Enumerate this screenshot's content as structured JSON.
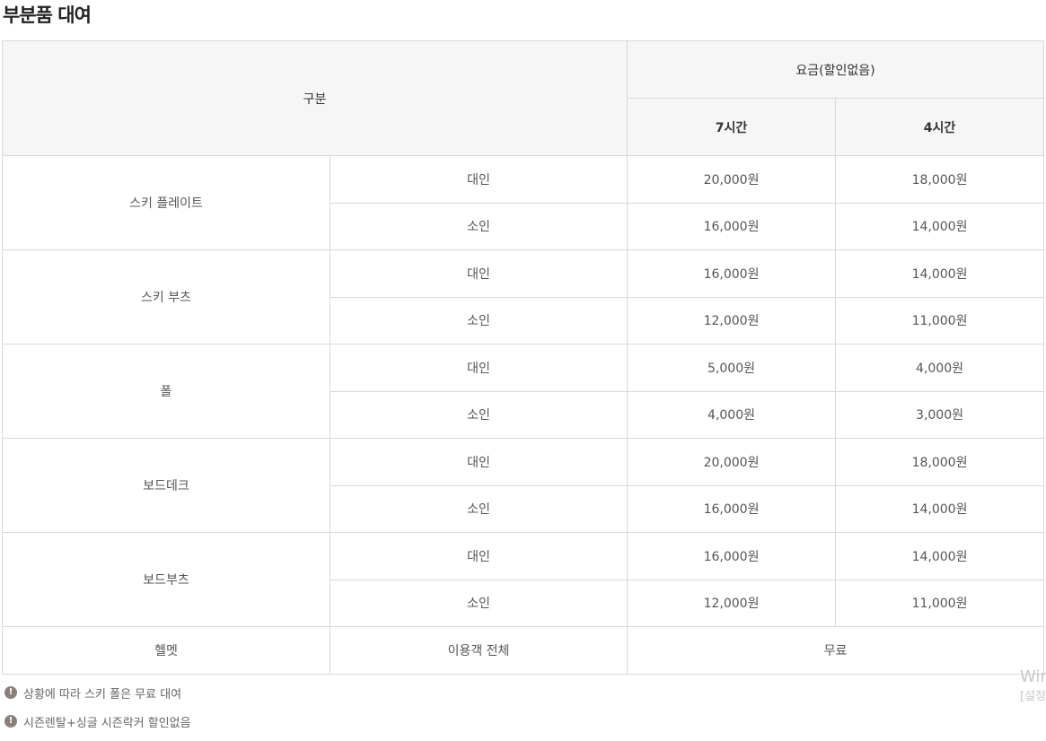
{
  "page": {
    "title": "부분품 대여"
  },
  "table": {
    "header": {
      "category": "구분",
      "price_group": "요금(할인없음)",
      "col_7h": "7시간",
      "col_4h": "4시간"
    },
    "groups": [
      {
        "name": "스키 플레이트",
        "rows": [
          {
            "type": "대인",
            "h7": "20,000원",
            "h4": "18,000원"
          },
          {
            "type": "소인",
            "h7": "16,000원",
            "h4": "14,000원"
          }
        ]
      },
      {
        "name": "스키 부츠",
        "rows": [
          {
            "type": "대인",
            "h7": "16,000원",
            "h4": "14,000원"
          },
          {
            "type": "소인",
            "h7": "12,000원",
            "h4": "11,000원"
          }
        ]
      },
      {
        "name": "폴",
        "rows": [
          {
            "type": "대인",
            "h7": "5,000원",
            "h4": "4,000원"
          },
          {
            "type": "소인",
            "h7": "4,000원",
            "h4": "3,000원"
          }
        ]
      },
      {
        "name": "보드데크",
        "rows": [
          {
            "type": "대인",
            "h7": "20,000원",
            "h4": "18,000원"
          },
          {
            "type": "소인",
            "h7": "16,000원",
            "h4": "14,000원"
          }
        ]
      },
      {
        "name": "보드부츠",
        "rows": [
          {
            "type": "대인",
            "h7": "16,000원",
            "h4": "14,000원"
          },
          {
            "type": "소인",
            "h7": "12,000원",
            "h4": "11,000원"
          }
        ]
      }
    ],
    "helmet": {
      "name": "헬멧",
      "type": "이용객 전체",
      "price": "무료"
    }
  },
  "notes": [
    {
      "icon": "exclamation-icon",
      "icon_glyph": "!",
      "text": "상황에 따라 스키 폴은 무료 대여"
    },
    {
      "icon": "exclamation-icon",
      "icon_glyph": "!",
      "text": "시즌렌탈+싱글 시즌락커 할인없음"
    }
  ],
  "watermark": {
    "line1": "Wir",
    "line2": "[설정"
  },
  "colors": {
    "header_bg": "#f6f6f6",
    "border": "#d9d9d9",
    "note_icon": "#8a7f79"
  }
}
